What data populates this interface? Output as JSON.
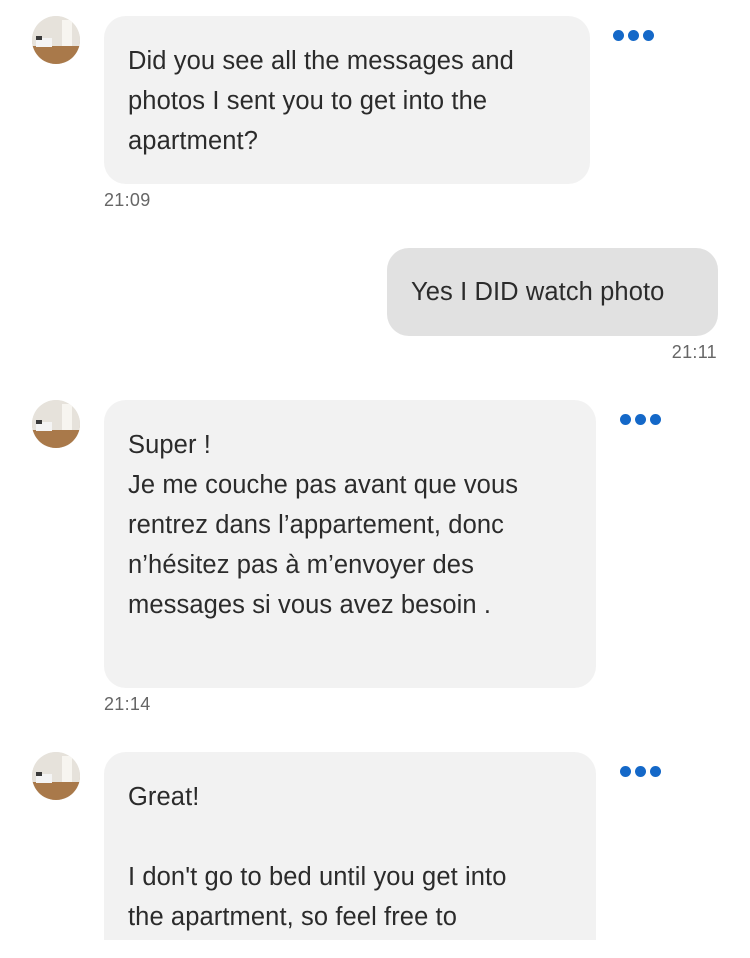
{
  "messages": [
    {
      "lines": [
        "Did you see all the messages and",
        "photos I sent you to get into the",
        "apartment?"
      ],
      "time": "21:09"
    },
    {
      "lines": [
        "Yes I DID watch photo"
      ],
      "time": "21:11"
    },
    {
      "lines": [
        "Super !",
        "Je me couche pas avant que vous",
        "rentrez dans l’appartement, donc",
        "n’hésitez pas à m’envoyer des",
        "messages si vous avez besoin ."
      ],
      "time": "21:14"
    },
    {
      "lines": [
        "Great!",
        "",
        "I don't go to bed until you get into",
        "the apartment, so feel free to"
      ]
    }
  ],
  "icons": {
    "avatar": "room-photo-avatar",
    "more": "more-options-icon",
    "accent_color": "#1468c8"
  }
}
